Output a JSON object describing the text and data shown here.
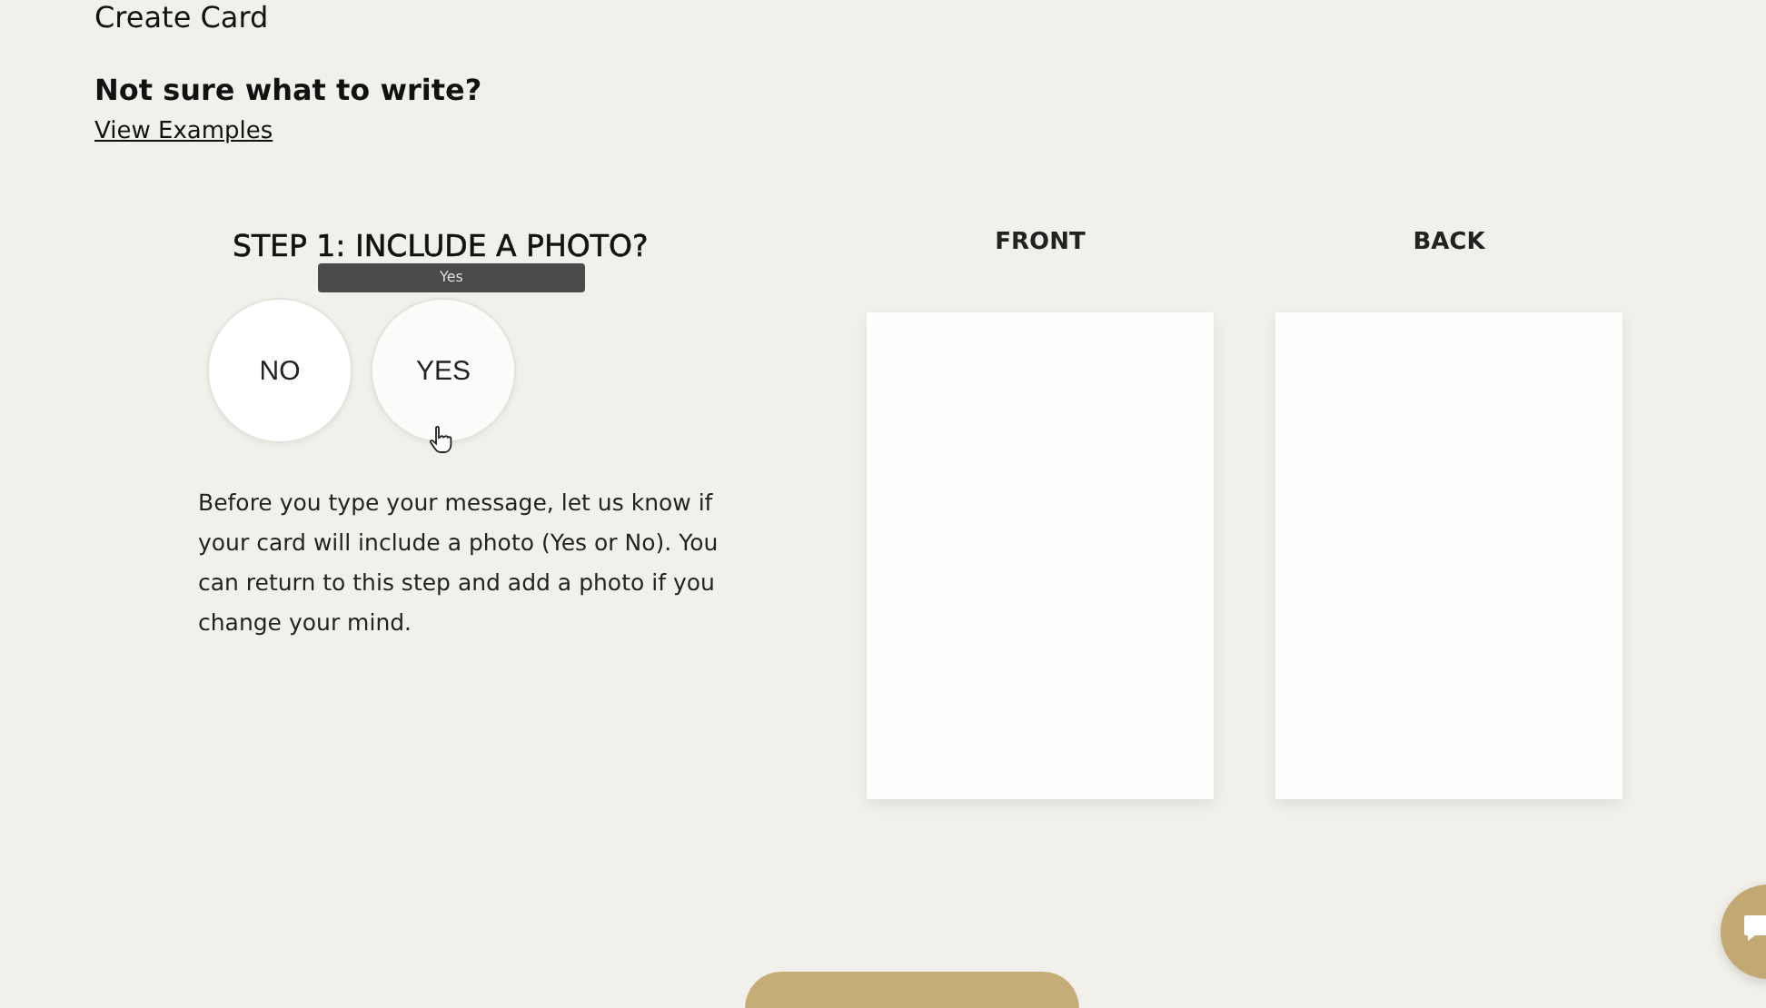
{
  "page_title": "Create Card",
  "help": {
    "heading": "Not sure what to write?",
    "link": "View Examples"
  },
  "step": {
    "title": "STEP 1: INCLUDE A PHOTO?",
    "options": [
      {
        "label": "NO",
        "hovered": false
      },
      {
        "label": "YES",
        "hovered": true
      }
    ],
    "tooltip": "Yes",
    "description": "Before you type your message, let us know if your card will include a photo (Yes or No). You can return to this step and add a photo if you change your mind."
  },
  "previews": [
    {
      "label": "FRONT"
    },
    {
      "label": "BACK"
    }
  ]
}
